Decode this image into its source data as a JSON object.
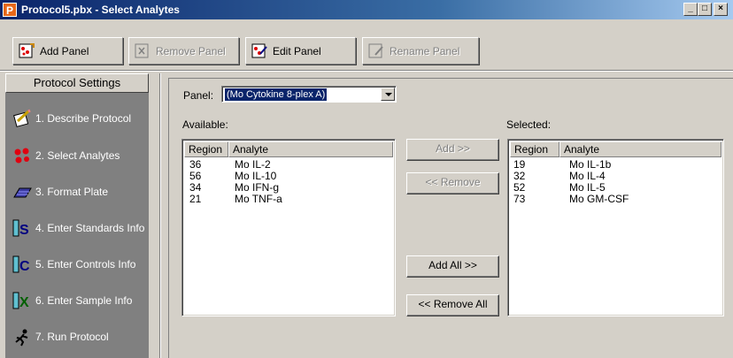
{
  "window": {
    "title": "Protocol5.pbx - Select Analytes",
    "app_icon_letter": "P",
    "buttons": {
      "minimize": "_",
      "maximize": "□",
      "close": "×"
    }
  },
  "toolbar": {
    "add_panel": "Add Panel",
    "remove_panel": "Remove Panel",
    "edit_panel": "Edit Panel",
    "rename_panel": "Rename Panel"
  },
  "sidebar": {
    "header": "Protocol Settings",
    "items": [
      {
        "label": "1. Describe Protocol",
        "icon": "pencil-paper-icon"
      },
      {
        "label": "2. Select Analytes",
        "icon": "beads-icon"
      },
      {
        "label": "3. Format Plate",
        "icon": "plate-icon"
      },
      {
        "label": "4. Enter Standards Info",
        "icon": "standards-tube-icon"
      },
      {
        "label": "5. Enter Controls Info",
        "icon": "controls-tube-icon"
      },
      {
        "label": "6. Enter Sample Info",
        "icon": "sample-tube-icon"
      },
      {
        "label": "7. Run Protocol",
        "icon": "runner-icon"
      }
    ]
  },
  "panel": {
    "label": "Panel:",
    "selected": "(Mo Cytokine 8-plex A)"
  },
  "available": {
    "label": "Available:",
    "columns": [
      "Region",
      "Analyte"
    ],
    "rows": [
      {
        "region": "36",
        "analyte": "Mo IL-2"
      },
      {
        "region": "56",
        "analyte": "Mo IL-10"
      },
      {
        "region": "34",
        "analyte": "Mo IFN-g"
      },
      {
        "region": "21",
        "analyte": "Mo TNF-a"
      }
    ]
  },
  "selected": {
    "label": "Selected:",
    "columns": [
      "Region",
      "Analyte"
    ],
    "rows": [
      {
        "region": "19",
        "analyte": "Mo IL-1b"
      },
      {
        "region": "32",
        "analyte": "Mo IL-4"
      },
      {
        "region": "52",
        "analyte": "Mo IL-5"
      },
      {
        "region": "73",
        "analyte": "Mo GM-CSF"
      }
    ]
  },
  "actions": {
    "add": "Add >>",
    "remove": "<< Remove",
    "add_all": "Add All >>",
    "remove_all": "<< Remove All"
  }
}
